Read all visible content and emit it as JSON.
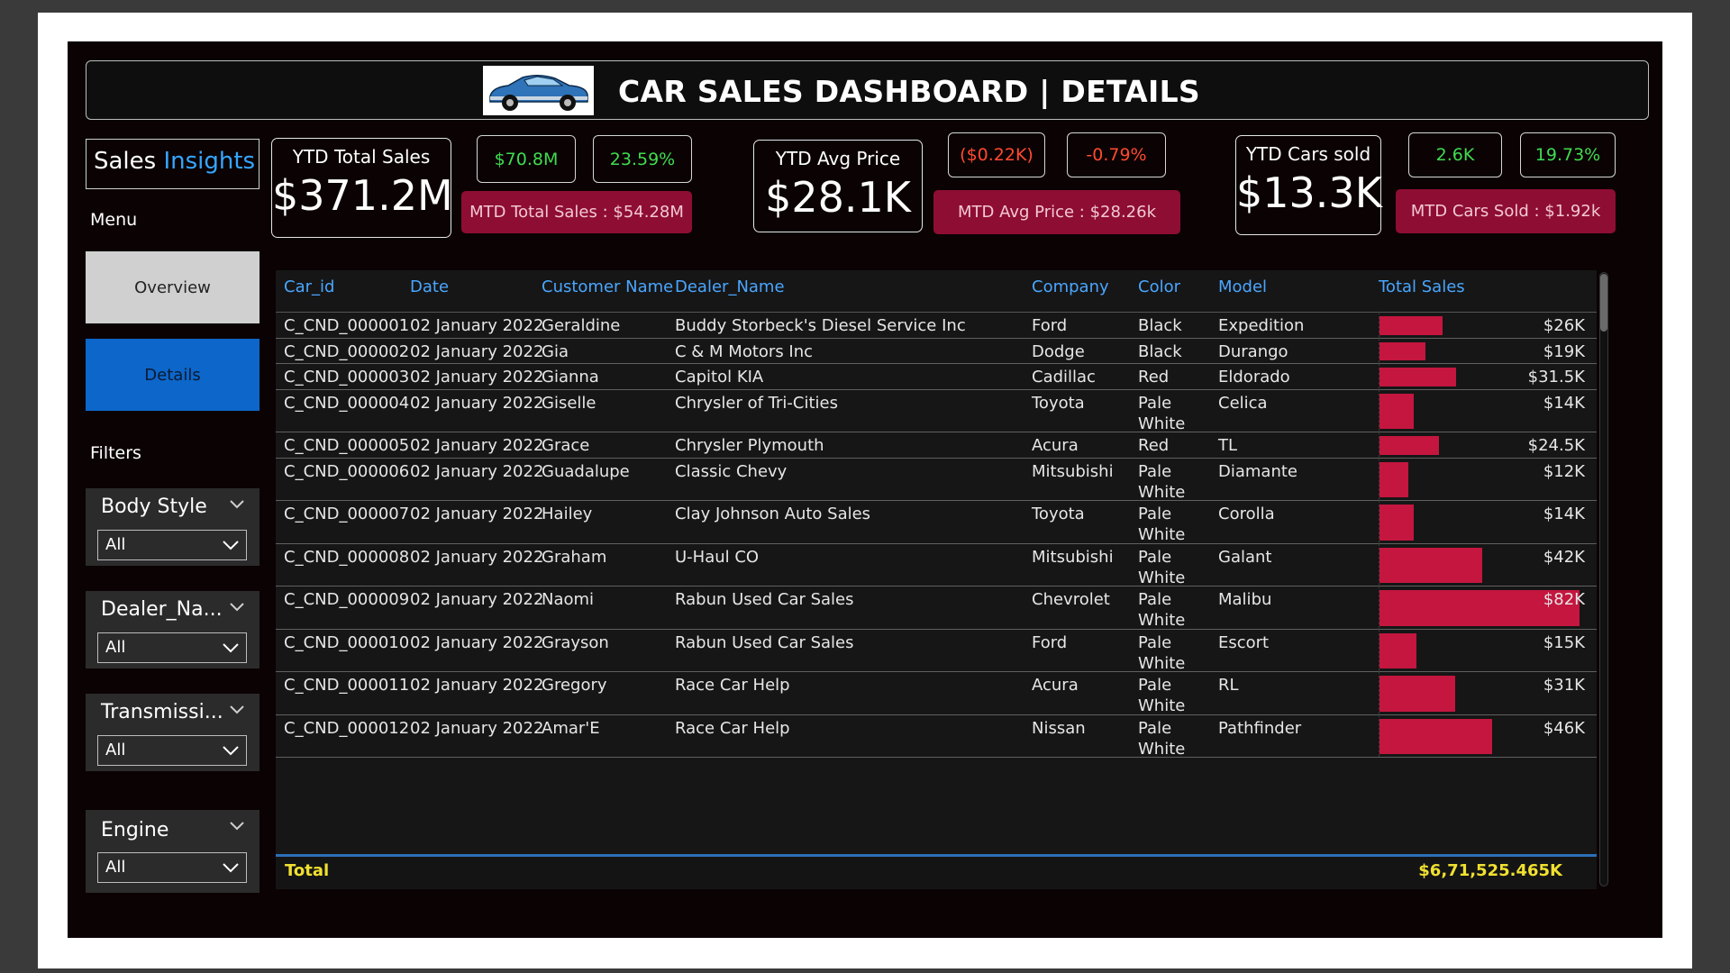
{
  "header": {
    "title": "CAR SALES DASHBOARD | DETAILS"
  },
  "sidebar": {
    "brand_part1": "Sales",
    "brand_part2": "Insights",
    "menu_label": "Menu",
    "nav": [
      {
        "label": "Overview"
      },
      {
        "label": "Details"
      }
    ],
    "filters_label": "Filters",
    "filters": [
      {
        "title": "Body Style",
        "value": "All"
      },
      {
        "title": "Dealer_Na...",
        "value": "All"
      },
      {
        "title": "Transmissi...",
        "value": "All"
      },
      {
        "title": "Engine",
        "value": "All"
      }
    ]
  },
  "kpis": {
    "total_sales": {
      "title": "YTD Total Sales",
      "value": "$371.2M",
      "delta_abs": "$70.8M",
      "delta_pct": "23.59%",
      "mtd": "MTD Total Sales : $54.28M"
    },
    "avg_price": {
      "title": "YTD Avg Price",
      "value": "$28.1K",
      "delta_abs": "($0.22K)",
      "delta_pct": "-0.79%",
      "mtd": "MTD Avg Price : $28.26k"
    },
    "cars_sold": {
      "title": "YTD Cars sold",
      "value": "$13.3K",
      "delta_abs": "2.6K",
      "delta_pct": "19.73%",
      "mtd": "MTD Cars Sold : $1.92k"
    }
  },
  "colors": {
    "accent_blue": "#0d66c9",
    "bar_red": "#c4163f",
    "positive": "#3fdc4f",
    "negative": "#ff4a2f",
    "total_yellow": "#f0e030"
  },
  "table": {
    "columns": [
      "Car_id",
      "Date",
      "Customer Name",
      "Dealer_Name",
      "Company",
      "Color",
      "Model",
      "Total Sales"
    ],
    "rows": [
      {
        "car_id": "C_CND_000001",
        "date": "02 January 2022",
        "customer": "Geraldine",
        "dealer": "Buddy Storbeck's Diesel Service Inc",
        "company": "Ford",
        "color1": "Black",
        "color2": "",
        "model": "Expedition",
        "sales_label": "$26K",
        "sales": 26000
      },
      {
        "car_id": "C_CND_000002",
        "date": "02 January 2022",
        "customer": "Gia",
        "dealer": "C & M Motors Inc",
        "company": "Dodge",
        "color1": "Black",
        "color2": "",
        "model": "Durango",
        "sales_label": "$19K",
        "sales": 19000
      },
      {
        "car_id": "C_CND_000003",
        "date": "02 January 2022",
        "customer": "Gianna",
        "dealer": "Capitol KIA",
        "company": "Cadillac",
        "color1": "Red",
        "color2": "",
        "model": "Eldorado",
        "sales_label": "$31.5K",
        "sales": 31500
      },
      {
        "car_id": "C_CND_000004",
        "date": "02 January 2022",
        "customer": "Giselle",
        "dealer": "Chrysler of Tri-Cities",
        "company": "Toyota",
        "color1": "Pale",
        "color2": "White",
        "model": "Celica",
        "sales_label": "$14K",
        "sales": 14000
      },
      {
        "car_id": "C_CND_000005",
        "date": "02 January 2022",
        "customer": "Grace",
        "dealer": "Chrysler Plymouth",
        "company": "Acura",
        "color1": "Red",
        "color2": "",
        "model": "TL",
        "sales_label": "$24.5K",
        "sales": 24500
      },
      {
        "car_id": "C_CND_000006",
        "date": "02 January 2022",
        "customer": "Guadalupe",
        "dealer": "Classic Chevy",
        "company": "Mitsubishi",
        "color1": "Pale",
        "color2": "White",
        "model": "Diamante",
        "sales_label": "$12K",
        "sales": 12000
      },
      {
        "car_id": "C_CND_000007",
        "date": "02 January 2022",
        "customer": "Hailey",
        "dealer": "Clay Johnson Auto Sales",
        "company": "Toyota",
        "color1": "Pale",
        "color2": "White",
        "model": "Corolla",
        "sales_label": "$14K",
        "sales": 14000
      },
      {
        "car_id": "C_CND_000008",
        "date": "02 January 2022",
        "customer": "Graham",
        "dealer": "U-Haul CO",
        "company": "Mitsubishi",
        "color1": "Pale",
        "color2": "White",
        "model": "Galant",
        "sales_label": "$42K",
        "sales": 42000
      },
      {
        "car_id": "C_CND_000009",
        "date": "02 January 2022",
        "customer": "Naomi",
        "dealer": "Rabun Used Car Sales",
        "company": "Chevrolet",
        "color1": "Pale",
        "color2": "White",
        "model": "Malibu",
        "sales_label": "$82K",
        "sales": 82000
      },
      {
        "car_id": "C_CND_000010",
        "date": "02 January 2022",
        "customer": "Grayson",
        "dealer": "Rabun Used Car Sales",
        "company": "Ford",
        "color1": "Pale",
        "color2": "White",
        "model": "Escort",
        "sales_label": "$15K",
        "sales": 15000
      },
      {
        "car_id": "C_CND_000011",
        "date": "02 January 2022",
        "customer": "Gregory",
        "dealer": "Race Car Help",
        "company": "Acura",
        "color1": "Pale",
        "color2": "White",
        "model": "RL",
        "sales_label": "$31K",
        "sales": 31000
      },
      {
        "car_id": "C_CND_000012",
        "date": "02 January 2022",
        "customer": "Amar'E",
        "dealer": "Race Car Help",
        "company": "Nissan",
        "color1": "Pale",
        "color2": "White",
        "model": "Pathfinder",
        "sales_label": "$46K",
        "sales": 46000
      }
    ],
    "total_label": "Total",
    "total_value": "$6,71,525.465K"
  }
}
